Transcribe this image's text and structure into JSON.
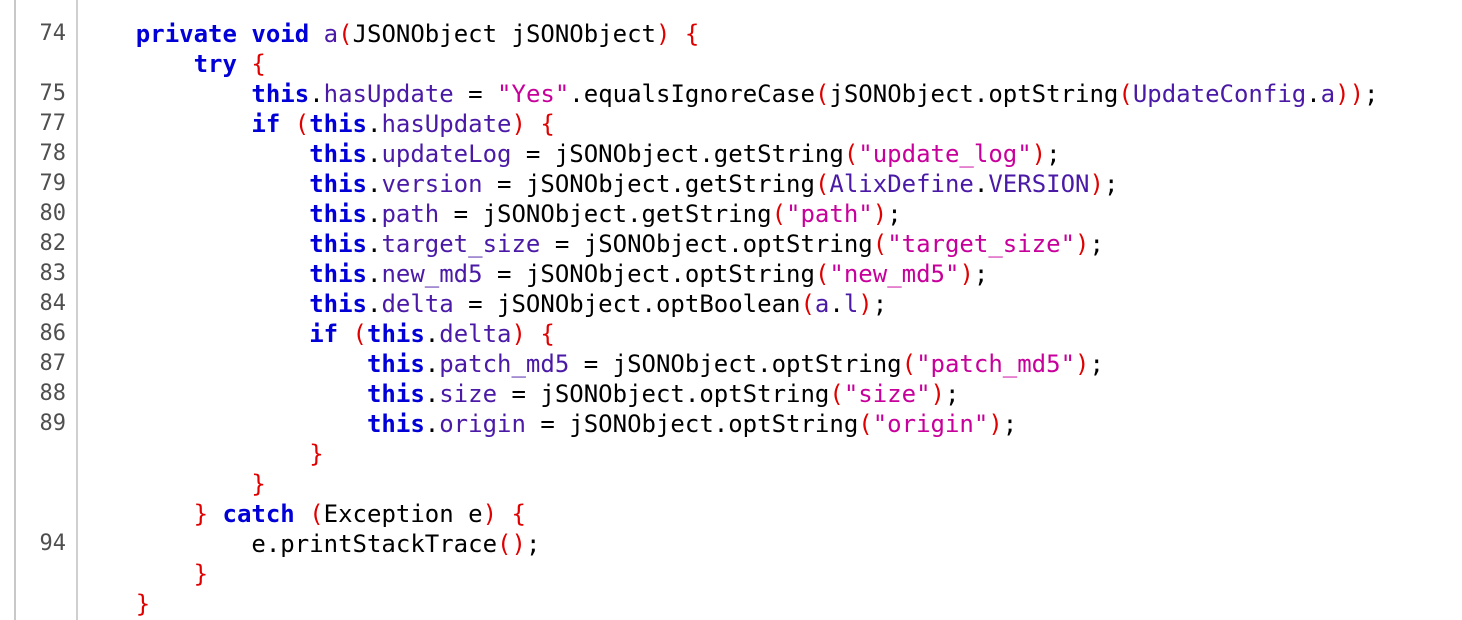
{
  "colors": {
    "keyword": "#0000d7",
    "string": "#c8009b",
    "field": "#4a1aa6",
    "bracket": "#e00000",
    "plain": "#000000",
    "line_number": "#4f4f4f"
  },
  "lines": [
    {
      "num": "74",
      "tokens": [
        {
          "t": "    ",
          "c": "pl"
        },
        {
          "t": "private",
          "c": "kw"
        },
        {
          "t": " ",
          "c": "pl"
        },
        {
          "t": "void",
          "c": "kw"
        },
        {
          "t": " ",
          "c": "pl"
        },
        {
          "t": "a",
          "c": "fld"
        },
        {
          "t": "(",
          "c": "br"
        },
        {
          "t": "JSONObject jSONObject",
          "c": "pl"
        },
        {
          "t": ")",
          "c": "br"
        },
        {
          "t": " ",
          "c": "pl"
        },
        {
          "t": "{",
          "c": "br"
        }
      ]
    },
    {
      "num": "",
      "tokens": [
        {
          "t": "        ",
          "c": "pl"
        },
        {
          "t": "try",
          "c": "kw"
        },
        {
          "t": " ",
          "c": "pl"
        },
        {
          "t": "{",
          "c": "br"
        }
      ]
    },
    {
      "num": "75",
      "tokens": [
        {
          "t": "            ",
          "c": "pl"
        },
        {
          "t": "this",
          "c": "kw"
        },
        {
          "t": ".",
          "c": "pl"
        },
        {
          "t": "hasUpdate",
          "c": "fld"
        },
        {
          "t": " = ",
          "c": "pl"
        },
        {
          "t": "\"Yes\"",
          "c": "str"
        },
        {
          "t": ".equalsIgnoreCase",
          "c": "pl"
        },
        {
          "t": "(",
          "c": "br"
        },
        {
          "t": "jSONObject.optString",
          "c": "pl"
        },
        {
          "t": "(",
          "c": "br"
        },
        {
          "t": "UpdateConfig",
          "c": "fld"
        },
        {
          "t": ".",
          "c": "pl"
        },
        {
          "t": "a",
          "c": "fld"
        },
        {
          "t": "))",
          "c": "br"
        },
        {
          "t": ";",
          "c": "pl"
        }
      ]
    },
    {
      "num": "77",
      "tokens": [
        {
          "t": "            ",
          "c": "pl"
        },
        {
          "t": "if",
          "c": "kw"
        },
        {
          "t": " ",
          "c": "pl"
        },
        {
          "t": "(",
          "c": "br"
        },
        {
          "t": "this",
          "c": "kw"
        },
        {
          "t": ".",
          "c": "pl"
        },
        {
          "t": "hasUpdate",
          "c": "fld"
        },
        {
          "t": ")",
          "c": "br"
        },
        {
          "t": " ",
          "c": "pl"
        },
        {
          "t": "{",
          "c": "br"
        }
      ]
    },
    {
      "num": "78",
      "tokens": [
        {
          "t": "                ",
          "c": "pl"
        },
        {
          "t": "this",
          "c": "kw"
        },
        {
          "t": ".",
          "c": "pl"
        },
        {
          "t": "updateLog",
          "c": "fld"
        },
        {
          "t": " = jSONObject.getString",
          "c": "pl"
        },
        {
          "t": "(",
          "c": "br"
        },
        {
          "t": "\"update_log\"",
          "c": "str"
        },
        {
          "t": ")",
          "c": "br"
        },
        {
          "t": ";",
          "c": "pl"
        }
      ]
    },
    {
      "num": "79",
      "tokens": [
        {
          "t": "                ",
          "c": "pl"
        },
        {
          "t": "this",
          "c": "kw"
        },
        {
          "t": ".",
          "c": "pl"
        },
        {
          "t": "version",
          "c": "fld"
        },
        {
          "t": " = jSONObject.getString",
          "c": "pl"
        },
        {
          "t": "(",
          "c": "br"
        },
        {
          "t": "AlixDefine",
          "c": "fld"
        },
        {
          "t": ".",
          "c": "pl"
        },
        {
          "t": "VERSION",
          "c": "fld"
        },
        {
          "t": ")",
          "c": "br"
        },
        {
          "t": ";",
          "c": "pl"
        }
      ]
    },
    {
      "num": "80",
      "tokens": [
        {
          "t": "                ",
          "c": "pl"
        },
        {
          "t": "this",
          "c": "kw"
        },
        {
          "t": ".",
          "c": "pl"
        },
        {
          "t": "path",
          "c": "fld"
        },
        {
          "t": " = jSONObject.getString",
          "c": "pl"
        },
        {
          "t": "(",
          "c": "br"
        },
        {
          "t": "\"path\"",
          "c": "str"
        },
        {
          "t": ")",
          "c": "br"
        },
        {
          "t": ";",
          "c": "pl"
        }
      ]
    },
    {
      "num": "82",
      "tokens": [
        {
          "t": "                ",
          "c": "pl"
        },
        {
          "t": "this",
          "c": "kw"
        },
        {
          "t": ".",
          "c": "pl"
        },
        {
          "t": "target_size",
          "c": "fld"
        },
        {
          "t": " = jSONObject.optString",
          "c": "pl"
        },
        {
          "t": "(",
          "c": "br"
        },
        {
          "t": "\"target_size\"",
          "c": "str"
        },
        {
          "t": ")",
          "c": "br"
        },
        {
          "t": ";",
          "c": "pl"
        }
      ]
    },
    {
      "num": "83",
      "tokens": [
        {
          "t": "                ",
          "c": "pl"
        },
        {
          "t": "this",
          "c": "kw"
        },
        {
          "t": ".",
          "c": "pl"
        },
        {
          "t": "new_md5",
          "c": "fld"
        },
        {
          "t": " = jSONObject.optString",
          "c": "pl"
        },
        {
          "t": "(",
          "c": "br"
        },
        {
          "t": "\"new_md5\"",
          "c": "str"
        },
        {
          "t": ")",
          "c": "br"
        },
        {
          "t": ";",
          "c": "pl"
        }
      ]
    },
    {
      "num": "84",
      "tokens": [
        {
          "t": "                ",
          "c": "pl"
        },
        {
          "t": "this",
          "c": "kw"
        },
        {
          "t": ".",
          "c": "pl"
        },
        {
          "t": "delta",
          "c": "fld"
        },
        {
          "t": " = jSONObject.optBoolean",
          "c": "pl"
        },
        {
          "t": "(",
          "c": "br"
        },
        {
          "t": "a",
          "c": "fld"
        },
        {
          "t": ".",
          "c": "pl"
        },
        {
          "t": "l",
          "c": "fld"
        },
        {
          "t": ")",
          "c": "br"
        },
        {
          "t": ";",
          "c": "pl"
        }
      ]
    },
    {
      "num": "86",
      "tokens": [
        {
          "t": "                ",
          "c": "pl"
        },
        {
          "t": "if",
          "c": "kw"
        },
        {
          "t": " ",
          "c": "pl"
        },
        {
          "t": "(",
          "c": "br"
        },
        {
          "t": "this",
          "c": "kw"
        },
        {
          "t": ".",
          "c": "pl"
        },
        {
          "t": "delta",
          "c": "fld"
        },
        {
          "t": ")",
          "c": "br"
        },
        {
          "t": " ",
          "c": "pl"
        },
        {
          "t": "{",
          "c": "br"
        }
      ]
    },
    {
      "num": "87",
      "tokens": [
        {
          "t": "                    ",
          "c": "pl"
        },
        {
          "t": "this",
          "c": "kw"
        },
        {
          "t": ".",
          "c": "pl"
        },
        {
          "t": "patch_md5",
          "c": "fld"
        },
        {
          "t": " = jSONObject.optString",
          "c": "pl"
        },
        {
          "t": "(",
          "c": "br"
        },
        {
          "t": "\"patch_md5\"",
          "c": "str"
        },
        {
          "t": ")",
          "c": "br"
        },
        {
          "t": ";",
          "c": "pl"
        }
      ]
    },
    {
      "num": "88",
      "tokens": [
        {
          "t": "                    ",
          "c": "pl"
        },
        {
          "t": "this",
          "c": "kw"
        },
        {
          "t": ".",
          "c": "pl"
        },
        {
          "t": "size",
          "c": "fld"
        },
        {
          "t": " = jSONObject.optString",
          "c": "pl"
        },
        {
          "t": "(",
          "c": "br"
        },
        {
          "t": "\"size\"",
          "c": "str"
        },
        {
          "t": ")",
          "c": "br"
        },
        {
          "t": ";",
          "c": "pl"
        }
      ]
    },
    {
      "num": "89",
      "tokens": [
        {
          "t": "                    ",
          "c": "pl"
        },
        {
          "t": "this",
          "c": "kw"
        },
        {
          "t": ".",
          "c": "pl"
        },
        {
          "t": "origin",
          "c": "fld"
        },
        {
          "t": " = jSONObject.optString",
          "c": "pl"
        },
        {
          "t": "(",
          "c": "br"
        },
        {
          "t": "\"origin\"",
          "c": "str"
        },
        {
          "t": ")",
          "c": "br"
        },
        {
          "t": ";",
          "c": "pl"
        }
      ]
    },
    {
      "num": "",
      "tokens": [
        {
          "t": "                ",
          "c": "pl"
        },
        {
          "t": "}",
          "c": "br"
        }
      ]
    },
    {
      "num": "",
      "tokens": [
        {
          "t": "            ",
          "c": "pl"
        },
        {
          "t": "}",
          "c": "br"
        }
      ]
    },
    {
      "num": "",
      "tokens": [
        {
          "t": "        ",
          "c": "pl"
        },
        {
          "t": "}",
          "c": "br"
        },
        {
          "t": " ",
          "c": "pl"
        },
        {
          "t": "catch",
          "c": "kw"
        },
        {
          "t": " ",
          "c": "pl"
        },
        {
          "t": "(",
          "c": "br"
        },
        {
          "t": "Exception e",
          "c": "pl"
        },
        {
          "t": ")",
          "c": "br"
        },
        {
          "t": " ",
          "c": "pl"
        },
        {
          "t": "{",
          "c": "br"
        }
      ]
    },
    {
      "num": "94",
      "tokens": [
        {
          "t": "            e.printStackTrace",
          "c": "pl"
        },
        {
          "t": "()",
          "c": "br"
        },
        {
          "t": ";",
          "c": "pl"
        }
      ]
    },
    {
      "num": "",
      "tokens": [
        {
          "t": "        ",
          "c": "pl"
        },
        {
          "t": "}",
          "c": "br"
        }
      ]
    },
    {
      "num": "",
      "tokens": [
        {
          "t": "    ",
          "c": "pl"
        },
        {
          "t": "}",
          "c": "br"
        }
      ]
    }
  ]
}
